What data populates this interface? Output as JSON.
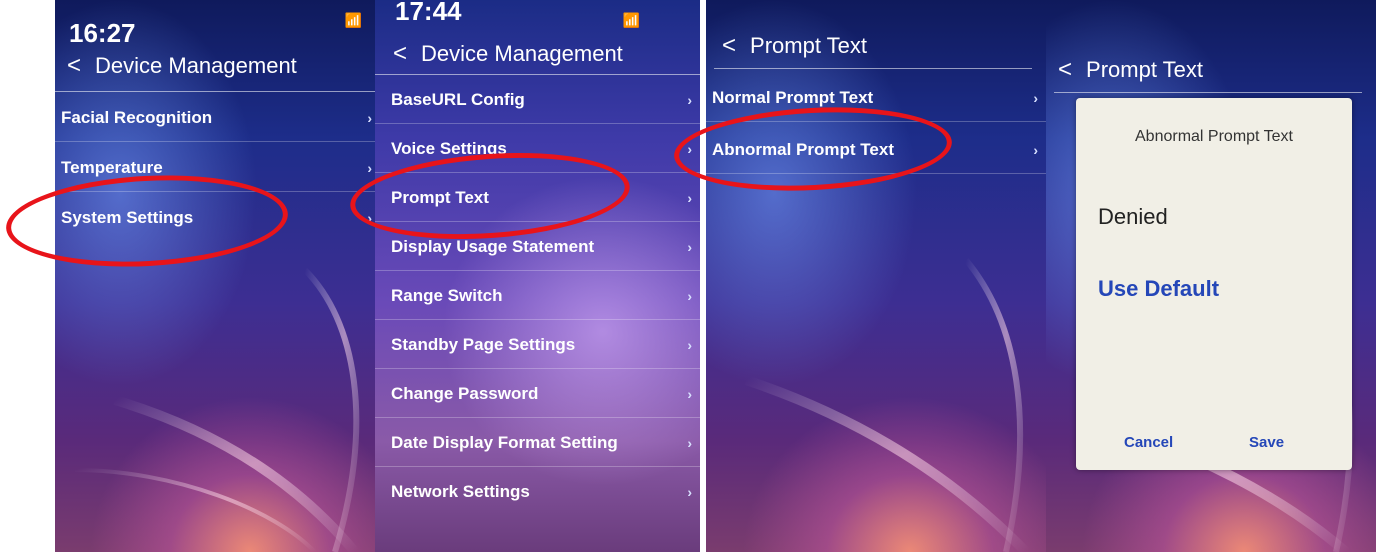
{
  "colors": {
    "highlight_ring": "#e8141a",
    "dialog_accent": "#2547b8",
    "dialog_bg": "#f1efe6"
  },
  "icons": {
    "back": "chevron-left-icon",
    "submenu": "chevron-right-icon",
    "network": "wifi-icon"
  },
  "panel1": {
    "time": "16:27",
    "title": "Device Management",
    "items": [
      {
        "label": "Facial Recognition"
      },
      {
        "label": "Temperature"
      },
      {
        "label": "System Settings"
      }
    ]
  },
  "panel2": {
    "time": "17:44",
    "title": "Device Management",
    "items": [
      {
        "label": "BaseURL Config"
      },
      {
        "label": "Voice Settings"
      },
      {
        "label": "Prompt Text"
      },
      {
        "label": "Display Usage Statement"
      },
      {
        "label": "Range Switch"
      },
      {
        "label": "Standby Page Settings"
      },
      {
        "label": "Change Password"
      },
      {
        "label": "Date Display Format Setting"
      },
      {
        "label": "Network Settings"
      }
    ]
  },
  "panel3": {
    "title": "Prompt Text",
    "items": [
      {
        "label": "Normal Prompt Text"
      },
      {
        "label": "Abnormal Prompt Text"
      }
    ]
  },
  "panel4": {
    "title": "Prompt Text",
    "dialog": {
      "title": "Abnormal Prompt Text",
      "value": "Denied",
      "default_label": "Use Default",
      "cancel": "Cancel",
      "save": "Save"
    }
  }
}
